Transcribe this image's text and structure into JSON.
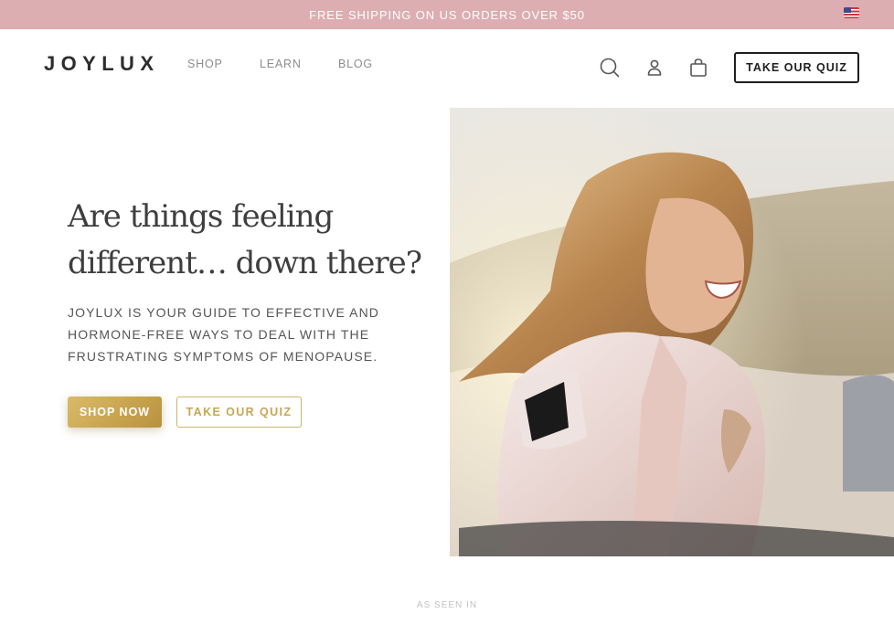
{
  "announcement": {
    "text": "FREE SHIPPING ON US ORDERS OVER $50",
    "flag_icon": "us-flag-icon"
  },
  "header": {
    "logo": "JOYLUX",
    "nav": [
      {
        "label": "SHOP"
      },
      {
        "label": "LEARN"
      },
      {
        "label": "BLOG"
      }
    ],
    "icons": [
      "search-icon",
      "account-icon",
      "cart-icon"
    ],
    "quiz_label": "TAKE OUR QUIZ"
  },
  "hero": {
    "headline_line1": "Are things feeling",
    "headline_line2": "different… down there?",
    "subtext_line1": "JOYLUX IS YOUR GUIDE TO EFFECTIVE AND",
    "subtext_line2": "HORMONE-FREE WAYS TO DEAL WITH THE",
    "subtext_line3": "FRUSTRATING SYMPTOMS OF MENOPAUSE.",
    "shop_label": "SHOP NOW",
    "quiz_label": "TAKE OUR QUIZ"
  },
  "press": {
    "heading": "AS SEEN IN"
  },
  "colors": {
    "announcement_bg": "#dcaeb1",
    "gold_accent": "#c9a44f",
    "text_dark": "#2d2d2d"
  }
}
